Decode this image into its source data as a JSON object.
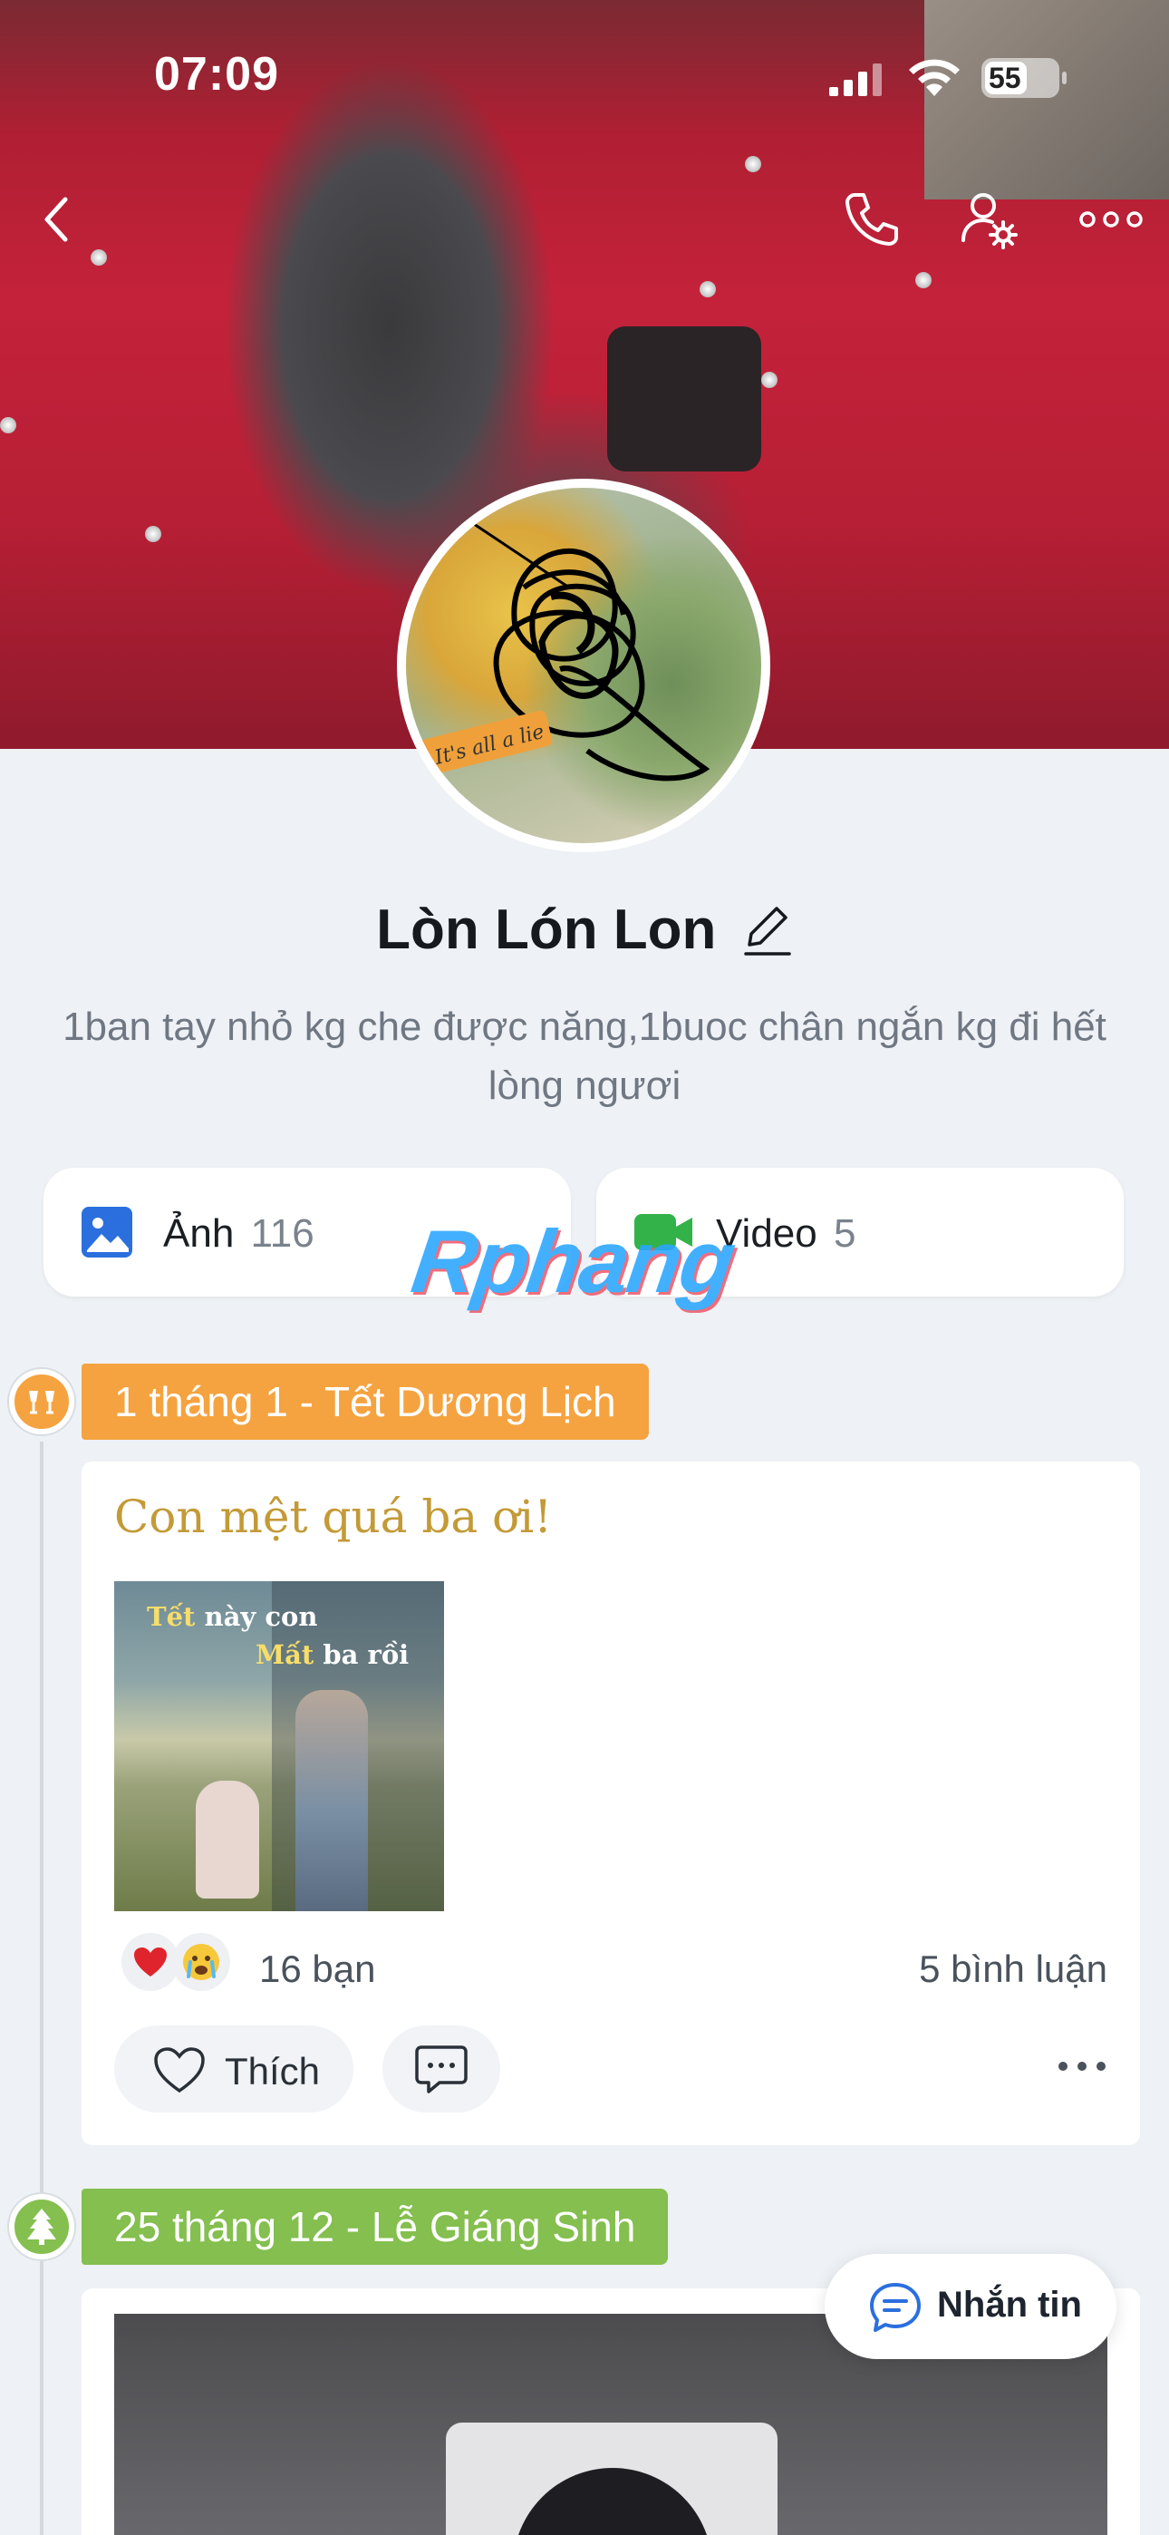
{
  "status_bar": {
    "time": "07:09",
    "battery": "55"
  },
  "profile": {
    "name": "Lòn Lón Lon",
    "bio": "1ban tay nhỏ kg che được năng,1buoc chân ngắn kg đi hết lòng ngươi"
  },
  "media": [
    {
      "label": "Ảnh",
      "count": "116",
      "icon": "photo-icon",
      "color": "#2b6fde"
    },
    {
      "label": "Video",
      "count": "5",
      "icon": "video-camera-icon",
      "color": "#33b24a"
    }
  ],
  "watermark": "Rphang",
  "timeline": [
    {
      "tag": "1 tháng 1 - Tết Dương Lịch",
      "tag_color": "#f5a340",
      "icon": "cheers-icon",
      "post": {
        "title": "Con mệt quá ba ơi!",
        "image_text_line1_highlight": "Tết",
        "image_text_line1_rest": " này con",
        "image_text_line2_highlight": "Mất",
        "image_text_line2_rest": " ba rồi",
        "reactions": [
          "heart-icon",
          "crying-face-icon"
        ],
        "reaction_count": "16 bạn",
        "comment_count": "5 bình luận",
        "like_label": "Thích"
      }
    },
    {
      "tag": "25 tháng 12 - Lễ Giáng Sinh",
      "tag_color": "#84bf4f",
      "icon": "christmas-tree-icon"
    }
  ],
  "message_button": {
    "label": "Nhắn tin"
  }
}
